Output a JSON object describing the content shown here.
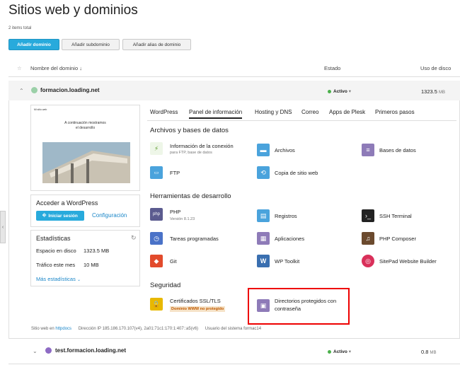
{
  "page": {
    "title": "Sitios web y dominios",
    "items_count": "2 items total",
    "buttons": {
      "add_domain": "Añadir dominio",
      "add_subdomain": "Añadir subdominio",
      "add_alias": "Añadir alias de dominio"
    },
    "columns": {
      "name": "Nombre del dominio ↓",
      "status": "Estado",
      "disk": "Uso de disco"
    }
  },
  "domains": [
    {
      "name": "formacion.loading.net",
      "status": "Activo",
      "status_caret": "▾",
      "disk": "1323.5",
      "disk_unit": "MB"
    },
    {
      "name": "test.formacion.loading.net",
      "status": "Activo",
      "status_caret": "▾",
      "disk": "0.8",
      "disk_unit": "MB"
    }
  ],
  "preview": {
    "brand": "Mi sitio web",
    "headline_1": "A continuación mostramos",
    "headline_2": "el desarrollo"
  },
  "wordpress_card": {
    "title": "Acceder a WordPress",
    "login": "Iniciar sesión",
    "config": "Configuración"
  },
  "stats_card": {
    "title": "Estadísticas",
    "disk_label": "Espacio en disco",
    "disk_value": "1323.5 MB",
    "traffic_label": "Tráfico este mes",
    "traffic_value": "10 MB",
    "more": "Más estadísticas"
  },
  "tabs": [
    "WordPress",
    "Panel de información",
    "Hosting y DNS",
    "Correo",
    "Apps de Plesk",
    "Primeros pasos"
  ],
  "sections": {
    "files": "Archivos y bases de datos",
    "dev": "Herramientas de desarrollo",
    "security": "Seguridad"
  },
  "tiles": {
    "conn_info": "Información de la conexión",
    "conn_info_sub": "para FTP, base de datos",
    "files": "Archivos",
    "databases": "Bases de datos",
    "ftp": "FTP",
    "backup": "Copia de sitio web",
    "php": "PHP",
    "php_sub": "Versión 8.1.23",
    "logs": "Registros",
    "ssh": "SSH Terminal",
    "cron": "Tareas programadas",
    "apps": "Aplicaciones",
    "composer": "PHP Composer",
    "git": "Git",
    "wp_toolkit": "WP Toolkit",
    "sitepad": "SitePad Website Builder",
    "ssl": "Certificados SSL/TLS",
    "ssl_badge": "Dominio WWW no protegido",
    "protected_dirs_1": "Directorios protegidos con",
    "protected_dirs_2": "contraseña"
  },
  "footer": {
    "web_label": "Sitio web en",
    "web_link": "httpdocs",
    "ip": "Dirección IP 185.186.170.107(v4), 2a01:71c1:170:1:407::a5(v6)",
    "user": "Usuario del sistema",
    "user_value": "formac14"
  },
  "icons": {
    "collapse": "chevron-down-icon",
    "pin": "pin-icon"
  },
  "colors": {
    "primary": "#28aadc",
    "active": "#4bb04b",
    "link": "#1a86c8",
    "highlight": "#e00000"
  }
}
